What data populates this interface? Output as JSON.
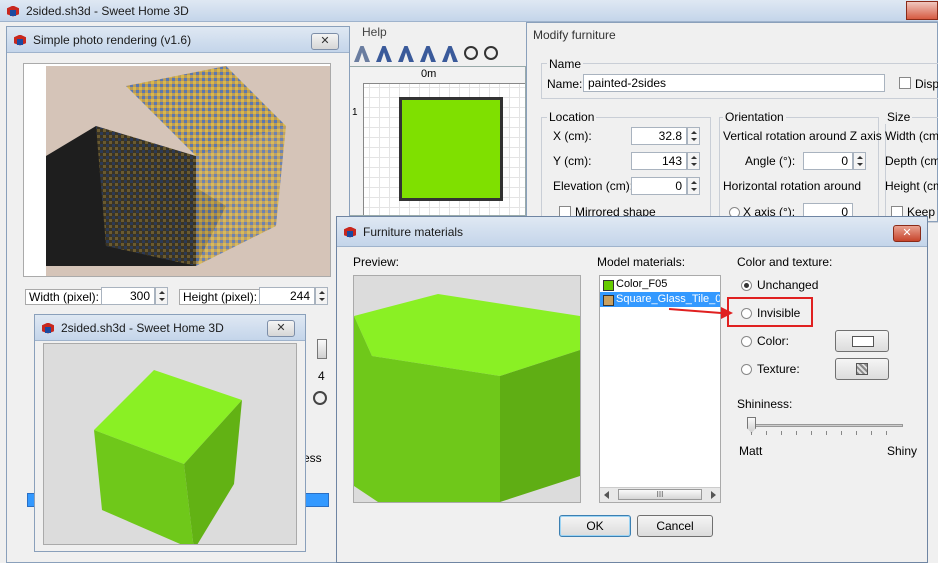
{
  "main_window": {
    "title": "2sided.sh3d - Sweet Home 3D",
    "corner_text": "c"
  },
  "menu": {
    "help": "Help"
  },
  "plan": {
    "ruler_top": "0m",
    "ruler_left": "1"
  },
  "photo_dialog": {
    "title": "Simple photo rendering (v1.6)",
    "width_label": "Width (pixel):",
    "width_value": "300",
    "height_label": "Height (pixel):",
    "height_value": "244",
    "quality_value": "4",
    "partial_text": "ess"
  },
  "view3d_window": {
    "title": "2sided.sh3d - Sweet Home 3D"
  },
  "modify_dialog": {
    "title": "Modify furniture",
    "name_section": "Name",
    "name_label": "Name:",
    "name_value": "painted-2sides",
    "display_label": "Displa",
    "location_section": "Location",
    "x_label": "X (cm):",
    "x_value": "32.8",
    "y_label": "Y (cm):",
    "y_value": "143",
    "elevation_label": "Elevation (cm):",
    "elevation_value": "0",
    "mirrored_label": "Mirrored shape",
    "orientation_section": "Orientation",
    "vertical_rotation": "Vertical rotation around Z axis",
    "angle_label": "Angle (°):",
    "angle_value": "0",
    "horizontal_rotation": "Horizontal rotation around",
    "x_axis_label": "X axis (°):",
    "x_axis_value": "0",
    "size_section": "Size",
    "width_label": "Width (cm):",
    "depth_label": "Depth (cm)",
    "height_label": "Height (cm)",
    "keep_label": "Keep p"
  },
  "materials_dialog": {
    "title": "Furniture materials",
    "preview_label": "Preview:",
    "model_materials_label": "Model materials:",
    "materials": [
      {
        "name": "Color_F05",
        "selected": false,
        "swatch": "#66cc00"
      },
      {
        "name": "Square_Glass_Tile_03",
        "selected": true,
        "swatch": "#c8a060"
      }
    ],
    "scroll_thumb": "III",
    "color_texture_label": "Color and texture:",
    "opt_unchanged": "Unchanged",
    "opt_invisible": "Invisible",
    "opt_color": "Color:",
    "opt_texture": "Texture:",
    "shininess_label": "Shininess:",
    "matt_label": "Matt",
    "shiny_label": "Shiny",
    "ok_label": "OK",
    "cancel_label": "Cancel"
  },
  "colors": {
    "accent_green": "#7fe000",
    "highlight_red": "#e02020",
    "selection_blue": "#3399ff"
  }
}
